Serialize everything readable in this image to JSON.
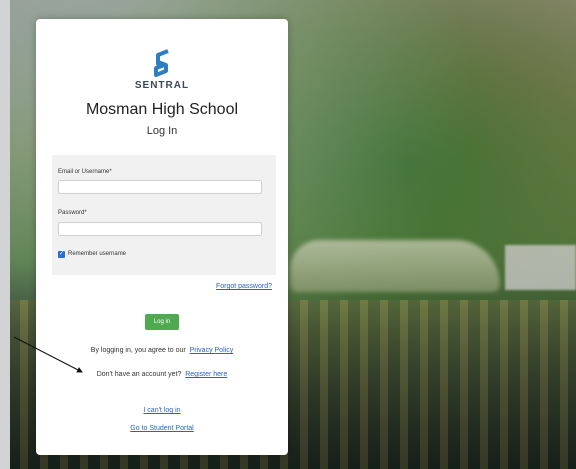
{
  "brand": {
    "name": "SENTRAL",
    "logo_icon": "sentral-s-logo-icon",
    "logo_color": "#2e7fbf"
  },
  "school": {
    "name": "Mosman High School"
  },
  "page": {
    "subtitle": "Log In"
  },
  "form": {
    "email_label": "Email or Username*",
    "email_value": "",
    "password_label": "Password*",
    "password_value": "",
    "remember_label": "Remember username",
    "remember_checked": true
  },
  "links": {
    "forgot": "Forgot password?",
    "login_button": "Log in",
    "agree_text": "By logging in, you agree to our",
    "privacy": "Privacy Policy",
    "no_account_text": "Don't have an account yet?",
    "register": "Register here",
    "cant_log_in": "I can't log in",
    "student_portal": "Go to Student Portal"
  },
  "colors": {
    "accent": "#2a62c4",
    "button": "#4eaa4e",
    "panel": "#f1f1f1"
  }
}
